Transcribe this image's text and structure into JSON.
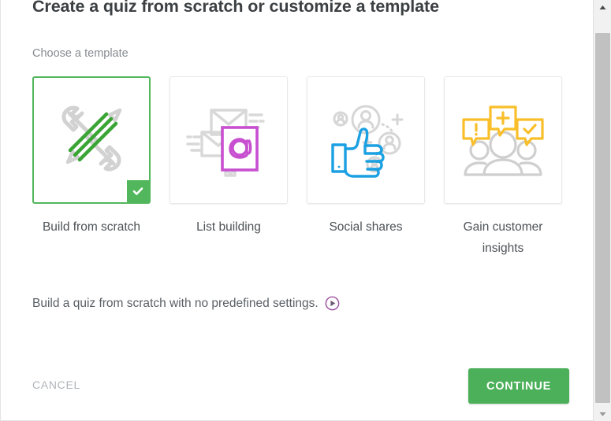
{
  "dialog": {
    "title": "Create a quiz from scratch or customize a template",
    "section_label": "Choose a template"
  },
  "templates": [
    {
      "id": "build-from-scratch",
      "label": "Build from scratch",
      "icon": "pencil-wrench-icon",
      "selected": true,
      "accent_color": "#3aa535",
      "muted_color": "#d2d2d2"
    },
    {
      "id": "list-building",
      "label": "List building",
      "icon": "envelopes-address-book-icon",
      "selected": false,
      "accent_color": "#c74fd0",
      "muted_color": "#d8d8d8"
    },
    {
      "id": "social-shares",
      "label": "Social shares",
      "icon": "thumbs-up-users-icon",
      "selected": false,
      "accent_color": "#1ba0e2",
      "muted_color": "#d8d8d8"
    },
    {
      "id": "gain-customer-insights",
      "label": "Gain customer insights",
      "icon": "people-speech-bubbles-icon",
      "selected": false,
      "accent_color": "#f9bf2a",
      "muted_color": "#cfcfcf"
    }
  ],
  "description": {
    "text": "Build a quiz from scratch with no predefined settings.",
    "play_icon": "play-circle-icon",
    "play_icon_color": "#9b4fa0"
  },
  "footer": {
    "cancel_label": "CANCEL",
    "continue_label": "CONTINUE",
    "continue_color": "#4cb05a"
  },
  "scrollbar": {
    "up_arrow_icon": "scroll-up-arrow-icon",
    "down_arrow_icon": "scroll-down-arrow-icon",
    "thumb": "scroll-thumb"
  },
  "selection_badge": {
    "icon": "checkmark-icon",
    "color": "#52b65c"
  }
}
